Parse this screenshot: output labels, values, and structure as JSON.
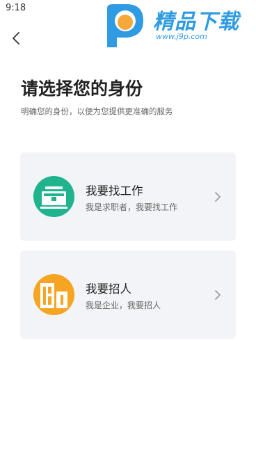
{
  "status_bar": {
    "time": "9:18"
  },
  "watermark": {
    "title": "精品下载",
    "url": "www.j9p.com"
  },
  "header": {
    "title": "请选择您的身份",
    "subtitle": "明确您的身份，以便为您提供更准确的服务"
  },
  "roles": [
    {
      "title": "我要找工作",
      "description": "我是求职者，我要找工作",
      "icon": "briefcase-icon",
      "color": "#1fb48e"
    },
    {
      "title": "我要招人",
      "description": "我是企业，我要招人",
      "icon": "building-icon",
      "color": "#f5a522"
    }
  ]
}
